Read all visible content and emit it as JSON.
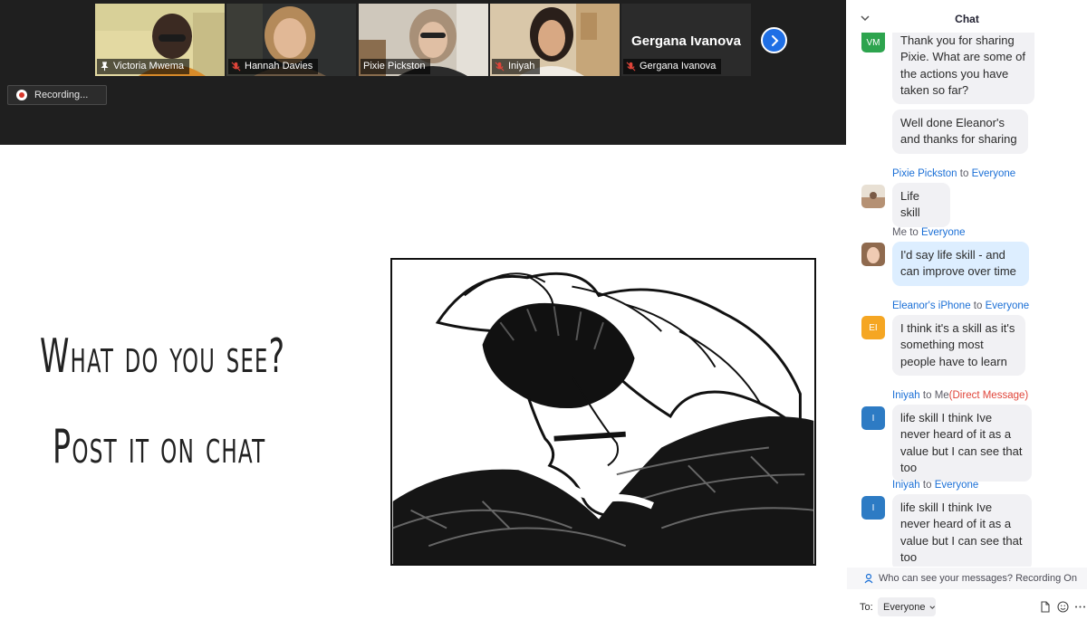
{
  "gallery": {
    "participants": [
      {
        "name": "Victoria Mwema",
        "pinned": true,
        "muted": false
      },
      {
        "name": "Hannah Davies",
        "pinned": false,
        "muted": true
      },
      {
        "name": "Pixie Pickston",
        "pinned": false,
        "muted": false
      },
      {
        "name": "Iniyah",
        "pinned": false,
        "muted": true
      },
      {
        "name": "Gergana Ivanova",
        "pinned": false,
        "muted": true,
        "display_name": "Gergana Ivanova"
      }
    ],
    "recording_label": "Recording..."
  },
  "slide": {
    "line1": "What do you see?",
    "line2": "Post it on chat"
  },
  "chat": {
    "title": "Chat",
    "messages": [
      {
        "sender": "",
        "to_word": "",
        "recipient": "",
        "avatar_initials": "VM",
        "avatar_color": "#2da44e",
        "text": "Thank you for sharing Pixie. What are some of the actions you have taken so far?"
      },
      {
        "sender": "",
        "to_word": "",
        "recipient": "",
        "avatar_initials": "",
        "avatar_color": "",
        "text": "Well done Eleanor's and thanks for sharing"
      },
      {
        "sender": "Pixie Pickston",
        "to_word": "to",
        "recipient": "Everyone",
        "avatar_initials": "",
        "avatar_color": "#c9a88a",
        "text": "Life skill"
      },
      {
        "sender": "Me",
        "to_word": "to",
        "recipient": "Everyone",
        "avatar_initials": "",
        "avatar_color": "#d9a88c",
        "text": "I'd say life skill - and can improve over time"
      },
      {
        "sender": "Eleanor's iPhone",
        "to_word": "to",
        "recipient": "Everyone",
        "avatar_initials": "EI",
        "avatar_color": "#f5a623",
        "text": "I think it's a skill as it's something most people have to learn"
      },
      {
        "sender": "Iniyah",
        "to_word": "to",
        "recipient": "Me",
        "dm_label": "(Direct Message)",
        "avatar_initials": "I",
        "avatar_color": "#2d7bc4",
        "text": "life skill I think Ive never heard of it as a value but I can see that too"
      },
      {
        "sender": "Iniyah",
        "to_word": "to",
        "recipient": "Everyone",
        "avatar_initials": "I",
        "avatar_color": "#2d7bc4",
        "text": "life skill I think Ive never heard of it as a value but I can see that too"
      }
    ],
    "privacy_text": "Who can see your messages? Recording On",
    "to_label": "To:",
    "to_value": "Everyone"
  },
  "colors": {
    "accent": "#1a6fd6",
    "dm": "#e0453a",
    "pinned_outline": "#b7d36a",
    "next_button": "#1f6fe5",
    "bubble_other": "#f1f1f4",
    "bubble_mine": "#ddeeff"
  },
  "icons": [
    "pin-icon",
    "mic-muted-icon",
    "chevron-right-icon",
    "record-icon",
    "chevron-down-icon",
    "person-icon",
    "file-icon",
    "emoji-icon",
    "more-icon"
  ]
}
